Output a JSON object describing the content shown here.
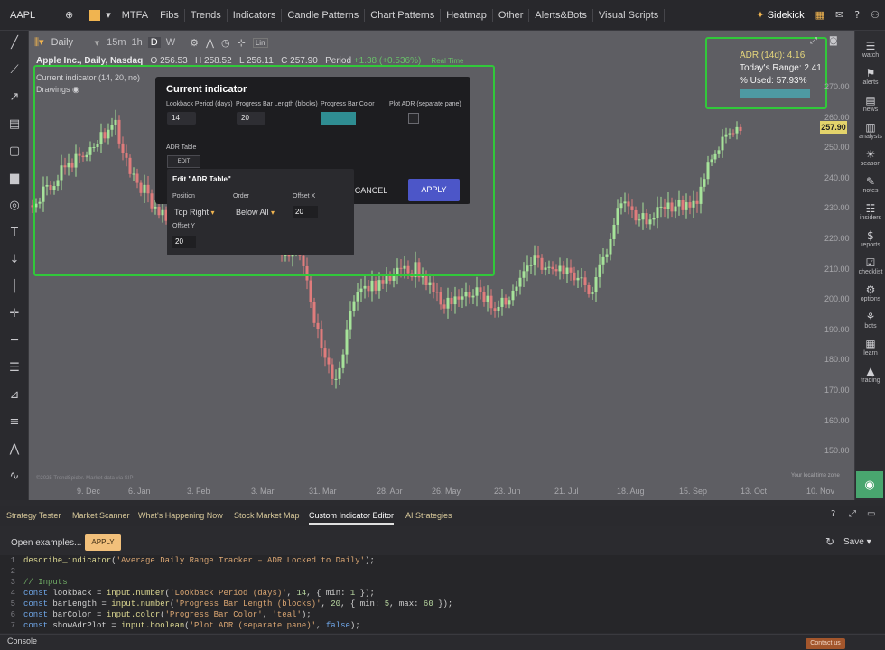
{
  "topbar": {
    "symbol": "AAPL",
    "mtfa": "MTFA",
    "menu": [
      "Fibs",
      "Trends",
      "Indicators",
      "Candle Patterns",
      "Chart Patterns",
      "Heatmap",
      "Other",
      "Alerts&Bots",
      "Visual Scripts"
    ],
    "sidekick": "Sidekick",
    "notif_count": "+"
  },
  "chart_header": {
    "interval": "Daily",
    "timeframes": [
      "15m",
      "1h",
      "D",
      "W"
    ],
    "active_tf": "D",
    "lin": "Lin"
  },
  "legend": {
    "name": "Apple Inc., Daily, Nasdaq",
    "open_label": "O",
    "open": "256.53",
    "high_label": "H",
    "high": "258.52",
    "low_label": "L",
    "low": "256.11",
    "close_label": "C",
    "close": "257.90",
    "period_label": "Period",
    "period": "+1.38 (+0.536%)",
    "realtime": "Real Time",
    "indicator": "Current indicator (14, 20, no)",
    "drawings": "Drawings"
  },
  "adr_table": {
    "title": "ADR (14d): 4.16",
    "range": "Today's Range: 2.41",
    "used": "% Used: 57.93%",
    "used_fraction": 0.5793,
    "bar_color": "#4e9aa2"
  },
  "price_axis": [
    "270.00",
    "260.00",
    "250.00",
    "240.00",
    "230.00",
    "220.00",
    "210.00",
    "200.00",
    "190.00",
    "180.00",
    "170.00",
    "160.00",
    "150.00"
  ],
  "last_price": "257.90",
  "date_axis": [
    "9. Dec",
    "6. Jan",
    "3. Feb",
    "3. Mar",
    "31. Mar",
    "28. Apr",
    "26. May",
    "23. Jun",
    "21. Jul",
    "18. Aug",
    "15. Sep",
    "13. Oct",
    "10. Nov"
  ],
  "chart_footer": {
    "left": "©2025 TrendSpider. Market data via SIP",
    "right": "Your local time zone"
  },
  "dialog": {
    "title": "Current indicator",
    "lookback_label": "Lookback Period (days)",
    "lookback_value": "14",
    "barlen_label": "Progress Bar Length (blocks)",
    "barlen_value": "20",
    "barcolor_label": "Progress Bar Color",
    "plot_label": "Plot ADR (separate pane)",
    "table_label": "ADR Table",
    "edit": "EDIT",
    "cancel": "CANCEL",
    "apply": "APPLY",
    "bar_color": "#2f8d92"
  },
  "subdialog": {
    "title": "Edit \"ADR Table\"",
    "position_label": "Position",
    "position_value": "Top Right",
    "order_label": "Order",
    "order_value": "Below All",
    "offx_label": "Offset X",
    "offx_value": "20",
    "offy_label": "Offset Y",
    "offy_value": "20"
  },
  "rightbar": [
    "watch",
    "alerts",
    "news",
    "analysts",
    "season",
    "notes",
    "insiders",
    "reports",
    "checklist",
    "options",
    "bots",
    "learn",
    "trading"
  ],
  "bottom_tabs": [
    "Strategy Tester",
    "Market Scanner",
    "What's Happening Now",
    "Stock Market Map",
    "Custom Indicator Editor",
    "AI Strategies"
  ],
  "active_bottom_tab": "Custom Indicator Editor",
  "editor": {
    "open_examples": "Open examples...",
    "apply": "APPLY",
    "save": "Save",
    "lines": [
      {
        "n": "1",
        "parts": [
          [
            "f",
            "describe_indicator"
          ],
          [
            "t",
            "("
          ],
          [
            "s",
            "'Average Daily Range Tracker – ADR Locked to Daily'"
          ],
          [
            "t",
            ");"
          ]
        ]
      },
      {
        "n": "2",
        "parts": []
      },
      {
        "n": "3",
        "parts": [
          [
            "c",
            "// Inputs"
          ]
        ]
      },
      {
        "n": "4",
        "parts": [
          [
            "k",
            "const "
          ],
          [
            "t",
            "lookback = "
          ],
          [
            "f",
            "input.number"
          ],
          [
            "t",
            "("
          ],
          [
            "s",
            "'Lookback Period (days)'"
          ],
          [
            "t",
            ", "
          ],
          [
            "n",
            "14"
          ],
          [
            "t",
            ", { min: "
          ],
          [
            "n",
            "1"
          ],
          [
            "t",
            " });"
          ]
        ]
      },
      {
        "n": "5",
        "parts": [
          [
            "k",
            "const "
          ],
          [
            "t",
            "barLength = "
          ],
          [
            "f",
            "input.number"
          ],
          [
            "t",
            "("
          ],
          [
            "s",
            "'Progress Bar Length (blocks)'"
          ],
          [
            "t",
            ", "
          ],
          [
            "n",
            "20"
          ],
          [
            "t",
            ", { min: "
          ],
          [
            "n",
            "5"
          ],
          [
            "t",
            ", max: "
          ],
          [
            "n",
            "60"
          ],
          [
            "t",
            " });"
          ]
        ]
      },
      {
        "n": "6",
        "parts": [
          [
            "k",
            "const "
          ],
          [
            "t",
            "barColor = "
          ],
          [
            "f",
            "input.color"
          ],
          [
            "t",
            "("
          ],
          [
            "s",
            "'Progress Bar Color'"
          ],
          [
            "t",
            ", "
          ],
          [
            "s",
            "'teal'"
          ],
          [
            "t",
            ");"
          ]
        ]
      },
      {
        "n": "7",
        "parts": [
          [
            "k",
            "const "
          ],
          [
            "t",
            "showAdrPlot = "
          ],
          [
            "f",
            "input.boolean"
          ],
          [
            "t",
            "("
          ],
          [
            "s",
            "'Plot ADR (separate pane)'"
          ],
          [
            "t",
            ", "
          ],
          [
            "k",
            "false"
          ],
          [
            "t",
            ");"
          ]
        ]
      }
    ]
  },
  "console": "Console",
  "contact": "Contact us"
}
